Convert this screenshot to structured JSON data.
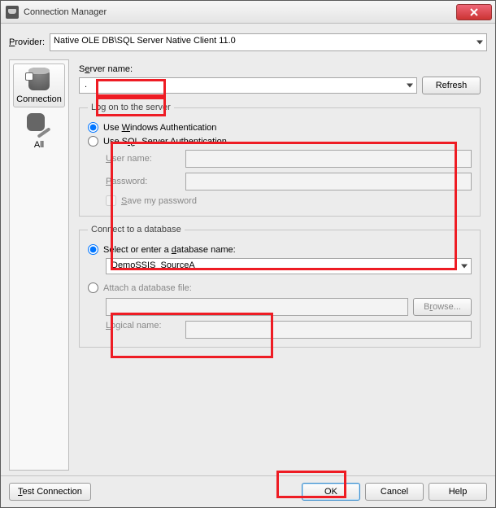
{
  "window": {
    "title": "Connection Manager"
  },
  "provider": {
    "label": "Provider:",
    "value": "Native OLE DB\\SQL Server Native Client 11.0"
  },
  "nav": {
    "connection": "Connection",
    "all": "All"
  },
  "server": {
    "label": "Server name:",
    "value": ".",
    "refresh": "Refresh"
  },
  "logon": {
    "legend": "Log on to the server",
    "use_windows": "Use Windows Authentication",
    "use_sql": "Use SQL Server Authentication",
    "user_label": "User name:",
    "pass_label": "Password:",
    "user_value": "",
    "pass_value": "",
    "save_pw": "Save my password"
  },
  "db": {
    "legend": "Connect to a database",
    "select_label": "Select or enter a database name:",
    "selected": "DemoSSIS_SourceA",
    "attach_label": "Attach a database file:",
    "browse": "Browse...",
    "logical_label": "Logical name:",
    "attach_value": "",
    "logical_value": ""
  },
  "footer": {
    "test": "Test Connection",
    "ok": "OK",
    "cancel": "Cancel",
    "help": "Help"
  }
}
